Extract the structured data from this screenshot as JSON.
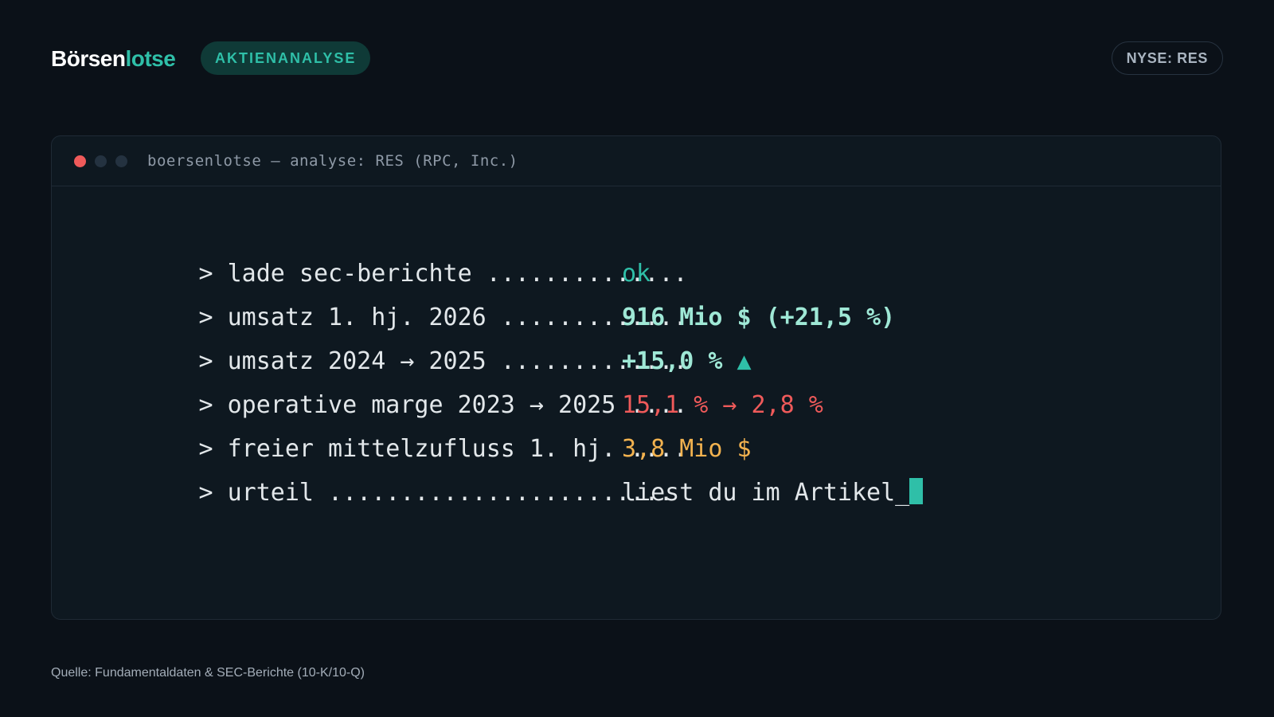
{
  "header": {
    "brand_part1": "Börsen",
    "brand_part2": "lotse",
    "category_tag": "AKTIENANALYSE",
    "ticker_badge": "NYSE: RES"
  },
  "terminal": {
    "title": "boersenlotse — analyse: RES (RPC, Inc.)",
    "lines": [
      {
        "label": "> lade sec-berichte ..............",
        "value": "ok"
      },
      {
        "label": "> umsatz 1. hj. 2026 .............",
        "value": "916 Mio $ (+21,5 %)"
      },
      {
        "label": "> umsatz 2024 → 2025 .............",
        "value": "+15,0 %",
        "marker": "▲"
      },
      {
        "label": "> operative marge 2023 → 2025 ....",
        "value": "15,1 % → 2,8 %"
      },
      {
        "label": "> freier mittelzufluss 1. hj. ....",
        "value": "3,8 Mio $"
      },
      {
        "label": "> urteil ........................",
        "value": "liest du im Artikel_"
      }
    ]
  },
  "footer": {
    "source": "Quelle: Fundamentaldaten & SEC-Berichte (10-K/10-Q)"
  },
  "colors": {
    "background": "#0b1118",
    "accent_teal": "#2fbfa8",
    "positive": "#9fe8d6",
    "negative": "#ef5a5a",
    "warning": "#f2b24f"
  },
  "icons": {
    "window_controls": [
      "close-dot-icon",
      "minimize-dot-icon",
      "maximize-dot-icon"
    ],
    "trend": "triangle-up-icon",
    "cursor": "block-cursor-icon"
  }
}
